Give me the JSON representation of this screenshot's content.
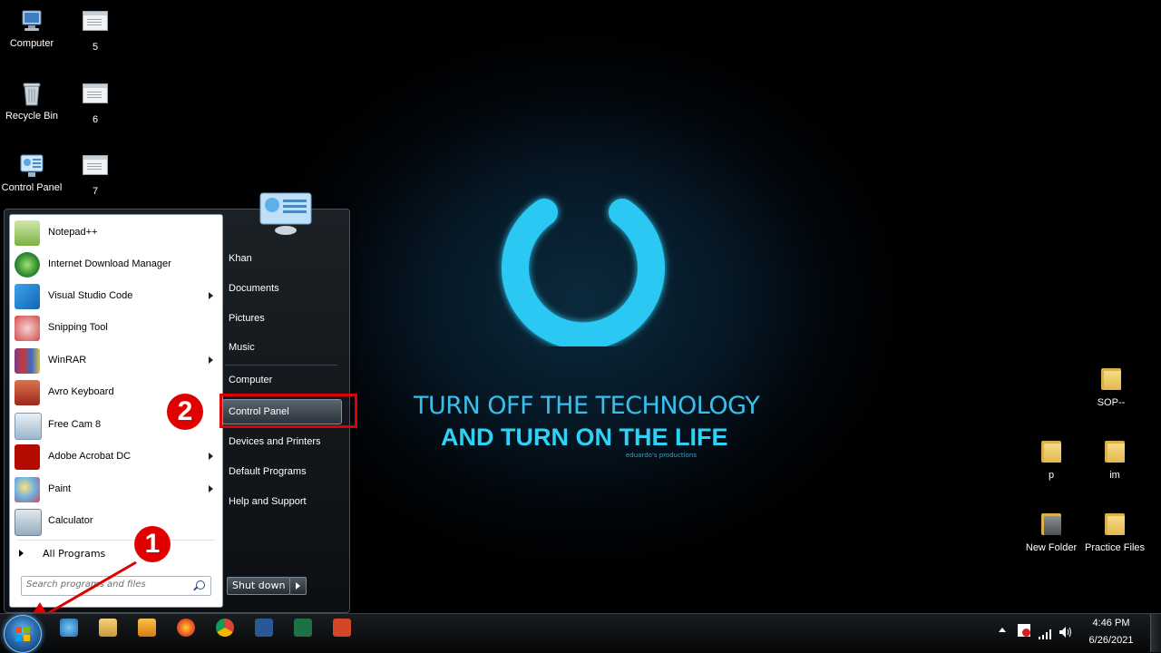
{
  "desktop": {
    "icons_left": [
      {
        "label": "Computer",
        "icon": "computer-icon"
      },
      {
        "label": "5",
        "icon": "document-icon"
      },
      {
        "label": "Recycle Bin",
        "icon": "recycle-bin-icon"
      },
      {
        "label": "6",
        "icon": "document-icon"
      },
      {
        "label": "Control Panel",
        "icon": "control-panel-icon"
      },
      {
        "label": "7",
        "icon": "document-icon"
      }
    ],
    "icons_right": [
      {
        "label": "SOP--",
        "icon": "folder-icon"
      },
      {
        "label": "p",
        "icon": "folder-icon"
      },
      {
        "label": "im",
        "icon": "folder-icon"
      },
      {
        "label": "New Folder",
        "icon": "folder-icon"
      },
      {
        "label": "Practice Files",
        "icon": "folder-icon"
      }
    ]
  },
  "wallpaper": {
    "line1": "TURN OFF THE TECHNOLOGY",
    "line2": "AND TURN ON THE LIFE",
    "credit": "eduardo's productions",
    "accent": "#2ed2f7"
  },
  "start_menu": {
    "programs": [
      {
        "label": "Notepad++",
        "icon": "notepad-plus-plus-icon",
        "submenu": false
      },
      {
        "label": "Internet Download Manager",
        "icon": "idm-icon",
        "submenu": false
      },
      {
        "label": "Visual Studio Code",
        "icon": "vscode-icon",
        "submenu": true
      },
      {
        "label": "Snipping Tool",
        "icon": "scissors-icon",
        "submenu": false
      },
      {
        "label": "WinRAR",
        "icon": "winrar-icon",
        "submenu": true
      },
      {
        "label": "Avro Keyboard",
        "icon": "avro-icon",
        "submenu": false
      },
      {
        "label": "Free Cam 8",
        "icon": "freecam-icon",
        "submenu": false
      },
      {
        "label": "Adobe Acrobat DC",
        "icon": "acrobat-icon",
        "submenu": true
      },
      {
        "label": "Paint",
        "icon": "paint-icon",
        "submenu": true
      },
      {
        "label": "Calculator",
        "icon": "calculator-icon",
        "submenu": false
      }
    ],
    "all_programs": "All Programs",
    "search_placeholder": "Search programs and files",
    "right_items": {
      "user": "Khan",
      "documents": "Documents",
      "pictures": "Pictures",
      "music": "Music",
      "computer": "Computer",
      "control_panel": "Control Panel",
      "devices": "Devices and Printers",
      "default_programs": "Default Programs",
      "help": "Help and Support"
    },
    "shutdown_label": "Shut down"
  },
  "annotations": {
    "step1": "1",
    "step2": "2",
    "color": "#e00000"
  },
  "taskbar": {
    "apps": [
      "internet-explorer-icon",
      "file-explorer-icon",
      "media-player-icon",
      "firefox-icon",
      "chrome-icon",
      "word-icon",
      "excel-icon",
      "powerpoint-icon"
    ],
    "time": "4:46 PM",
    "date": "6/26/2021"
  }
}
